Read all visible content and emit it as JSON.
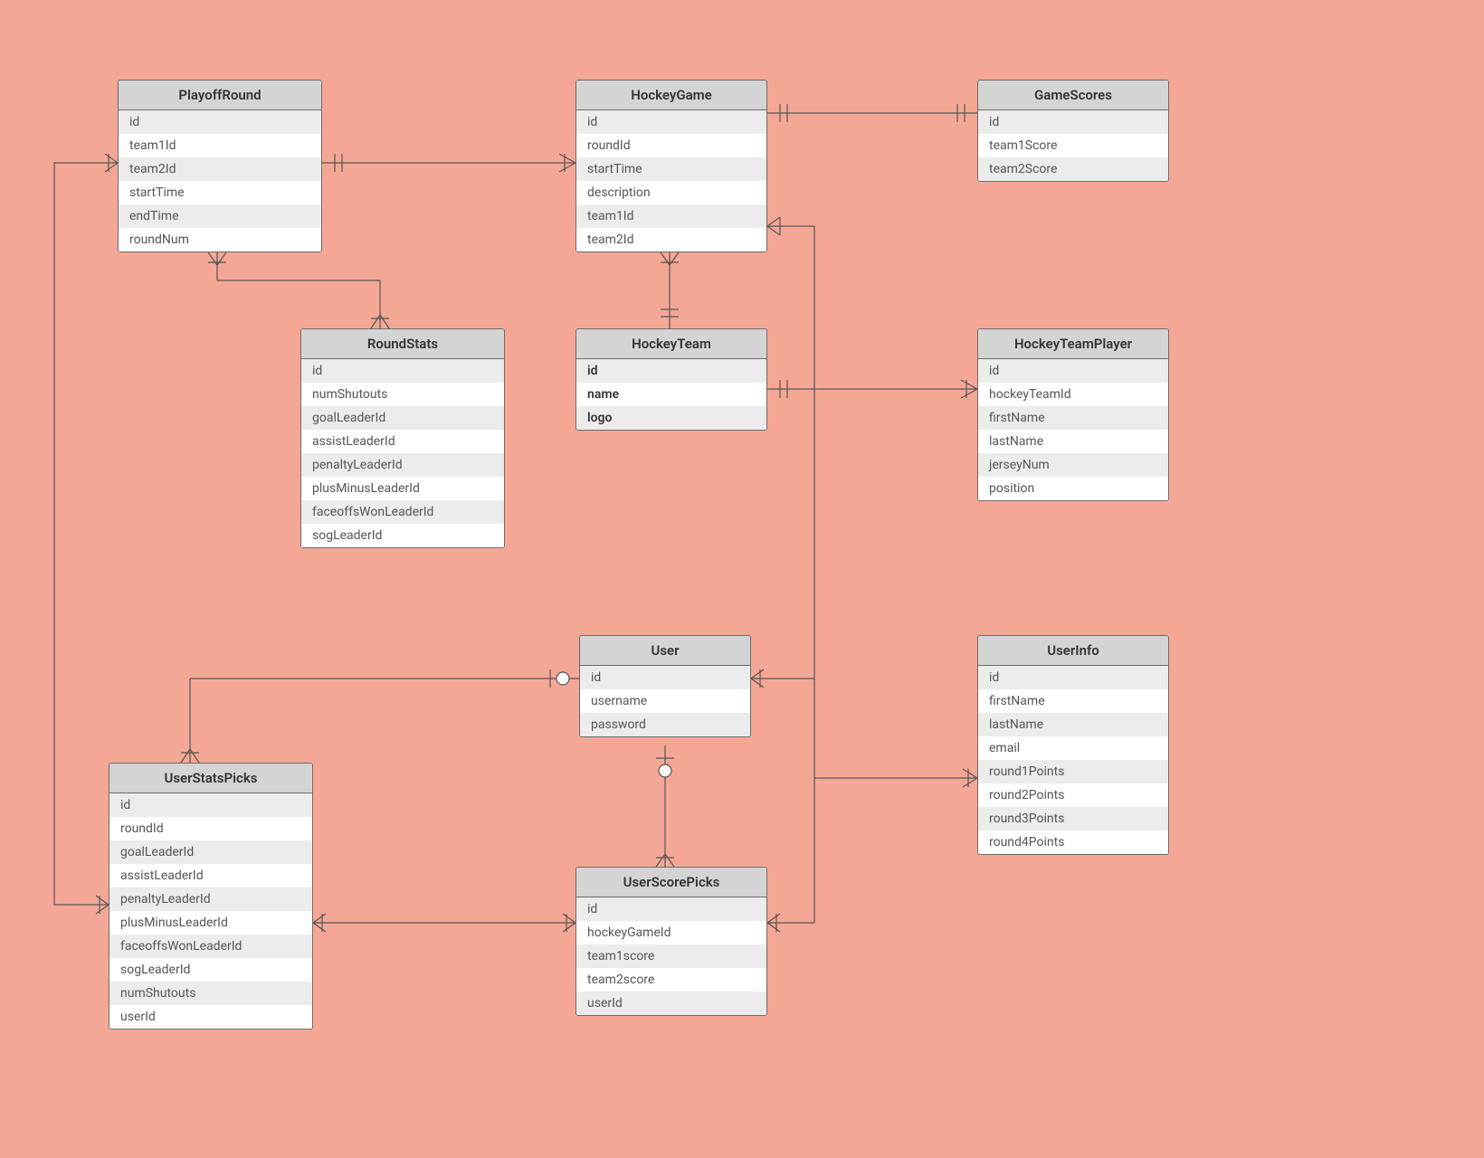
{
  "entities": {
    "playoffRound": {
      "title": "PlayoffRound",
      "fields": [
        "id",
        "team1Id",
        "team2Id",
        "startTime",
        "endTime",
        "roundNum"
      ]
    },
    "hockeyGame": {
      "title": "HockeyGame",
      "fields": [
        "id",
        "roundId",
        "startTime",
        "description",
        "team1Id",
        "team2Id"
      ]
    },
    "gameScores": {
      "title": "GameScores",
      "fields": [
        "id",
        "team1Score",
        "team2Score"
      ]
    },
    "roundStats": {
      "title": "RoundStats",
      "fields": [
        "id",
        "numShutouts",
        "goalLeaderId",
        "assistLeaderId",
        "penaltyLeaderId",
        "plusMinusLeaderId",
        "faceoffsWonLeaderId",
        "sogLeaderId"
      ]
    },
    "hockeyTeam": {
      "title": "HockeyTeam",
      "fields": [
        "id",
        "name",
        "logo"
      ],
      "boldFields": [
        0,
        1,
        2
      ]
    },
    "hockeyTeamPlayer": {
      "title": "HockeyTeamPlayer",
      "fields": [
        "id",
        "hockeyTeamId",
        "firstName",
        "lastName",
        "jerseyNum",
        "position"
      ]
    },
    "user": {
      "title": "User",
      "fields": [
        "id",
        "username",
        "password"
      ]
    },
    "userInfo": {
      "title": "UserInfo",
      "fields": [
        "id",
        "firstName",
        "lastName",
        "email",
        "round1Points",
        "round2Points",
        "round3Points",
        "round4Points"
      ]
    },
    "userStatsPicks": {
      "title": "UserStatsPicks",
      "fields": [
        "id",
        "roundId",
        "goalLeaderId",
        "assistLeaderId",
        "penaltyLeaderId",
        "plusMinusLeaderId",
        "faceoffsWonLeaderId",
        "sogLeaderId",
        "numShutouts",
        "userId"
      ]
    },
    "userScorePicks": {
      "title": "UserScorePicks",
      "fields": [
        "id",
        "hockeyGameId",
        "team1score",
        "team2score",
        "userId"
      ]
    }
  },
  "relationships": [
    {
      "from": "PlayoffRound",
      "to": "HockeyGame",
      "type": "one-to-many"
    },
    {
      "from": "HockeyGame",
      "to": "GameScores",
      "type": "one-to-one"
    },
    {
      "from": "PlayoffRound",
      "to": "RoundStats",
      "type": "one-to-many"
    },
    {
      "from": "HockeyTeam",
      "to": "HockeyGame",
      "type": "one-to-many"
    },
    {
      "from": "HockeyTeam",
      "to": "HockeyTeamPlayer",
      "type": "one-to-many"
    },
    {
      "from": "User",
      "to": "UserStatsPicks",
      "type": "zero-to-many"
    },
    {
      "from": "User",
      "to": "UserScorePicks",
      "type": "zero-to-many"
    },
    {
      "from": "User",
      "to": "UserInfo",
      "type": "one-to-many"
    },
    {
      "from": "PlayoffRound",
      "to": "UserStatsPicks",
      "type": "one-to-many"
    },
    {
      "from": "HockeyGame",
      "to": "User",
      "type": "one-to-many"
    },
    {
      "from": "HockeyGame",
      "to": "UserScorePicks",
      "type": "one-to-many"
    }
  ]
}
